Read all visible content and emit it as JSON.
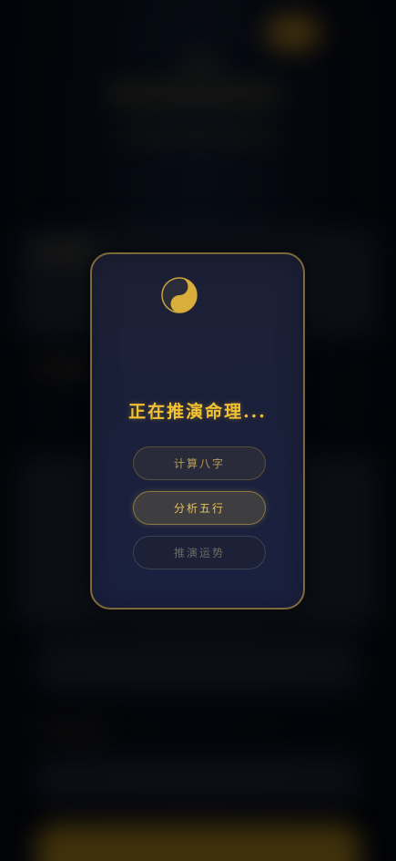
{
  "modal": {
    "title": "正在推演命理...",
    "steps": [
      {
        "label": "计算八字",
        "state": "done"
      },
      {
        "label": "分析五行",
        "state": "active"
      },
      {
        "label": "推演运势",
        "state": "pending"
      }
    ]
  },
  "icons": {
    "loading": "yin-yang-icon"
  },
  "colors": {
    "accent_gold": "#f2c233",
    "modal_border": "#7d6a3a",
    "modal_bg": "#1c2035",
    "page_bg": "#05070e"
  }
}
